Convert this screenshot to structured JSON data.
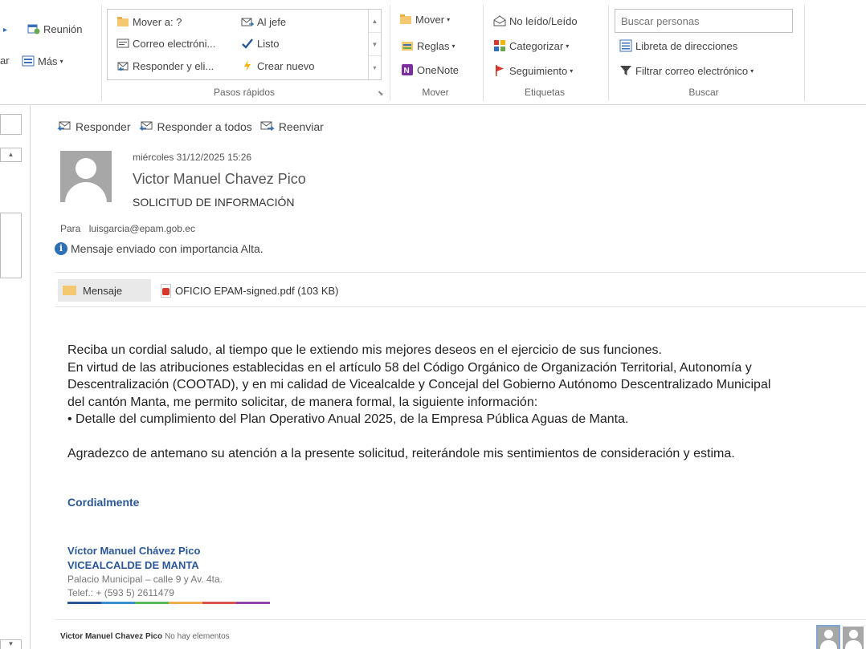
{
  "ribbon": {
    "left_items": {
      "meeting": "Reunión",
      "more": "Más",
      "truncated_left": "ar"
    },
    "quick_steps": {
      "move_to": "Mover a: ?",
      "to_manager": "Al jefe",
      "email": "Correo electróni...",
      "done": "Listo",
      "reply_delete": "Responder y eli...",
      "create_new": "Crear nuevo",
      "group_label": "Pasos rápidos"
    },
    "move_group": {
      "move": "Mover",
      "rules": "Reglas",
      "onenote": "OneNote",
      "group_label": "Mover"
    },
    "tags_group": {
      "unread_read": "No leído/Leído",
      "categorize": "Categorizar",
      "follow_up": "Seguimiento",
      "group_label": "Etiquetas"
    },
    "find_group": {
      "search_placeholder": "Buscar personas",
      "address_book": "Libreta de direcciones",
      "filter_email": "Filtrar correo electrónico",
      "group_label": "Buscar"
    }
  },
  "message": {
    "actions": {
      "reply": "Responder",
      "reply_all": "Responder a todos",
      "forward": "Reenviar"
    },
    "date": "miércoles 31/12/2025 15:26",
    "sender": "Victor Manuel Chavez Pico",
    "subject": "SOLICITUD DE INFORMACIÓN",
    "to_label": "Para",
    "to_address": "luisgarcia@epam.gob.ec",
    "importance_notice": "Mensaje enviado con importancia Alta.",
    "message_tab": "Mensaje",
    "attachment": "OFICIO EPAM-signed.pdf (103 KB)",
    "body": {
      "line1": "Reciba un cordial saludo, al tiempo que le extiendo mis mejores deseos en el ejercicio de sus funciones.",
      "line2": "En virtud de las atribuciones establecidas en el artículo 58 del Código Orgánico de Organización Territorial, Autonomía y",
      "line3": "Descentralización (COOTAD), y en mi calidad de Vicealcalde y Concejal del Gobierno Autónomo Descentralizado Municipal",
      "line4": "del cantón Manta, me permito solicitar, de manera formal, la siguiente información:",
      "line5": "• Detalle del cumplimiento del Plan Operativo Anual 2025, de la Empresa Pública Aguas de Manta.",
      "line6": "Agradezco de antemano su atención a la presente solicitud, reiterándole mis sentimientos de consideración y estima."
    },
    "closing": "Cordialmente",
    "signature": {
      "name": "Víctor Manuel Chávez Pico",
      "title": "VICEALCALDE DE MANTA",
      "address": "Palacio Municipal – calle 9 y Av. 4ta.",
      "phone": "Telef.: + (593 5) 2611479",
      "bar_colors": [
        "#2b5797",
        "#3a8fd0",
        "#5cb85c",
        "#f0ad4e",
        "#d9534f",
        "#8e44ad"
      ]
    }
  },
  "people_pane": {
    "name": "Victor Manuel Chavez Pico",
    "no_items": "No hay elementos"
  },
  "colors": {
    "accent_blue": "#2b5797",
    "avatar_gray": "#a7a7a7"
  }
}
